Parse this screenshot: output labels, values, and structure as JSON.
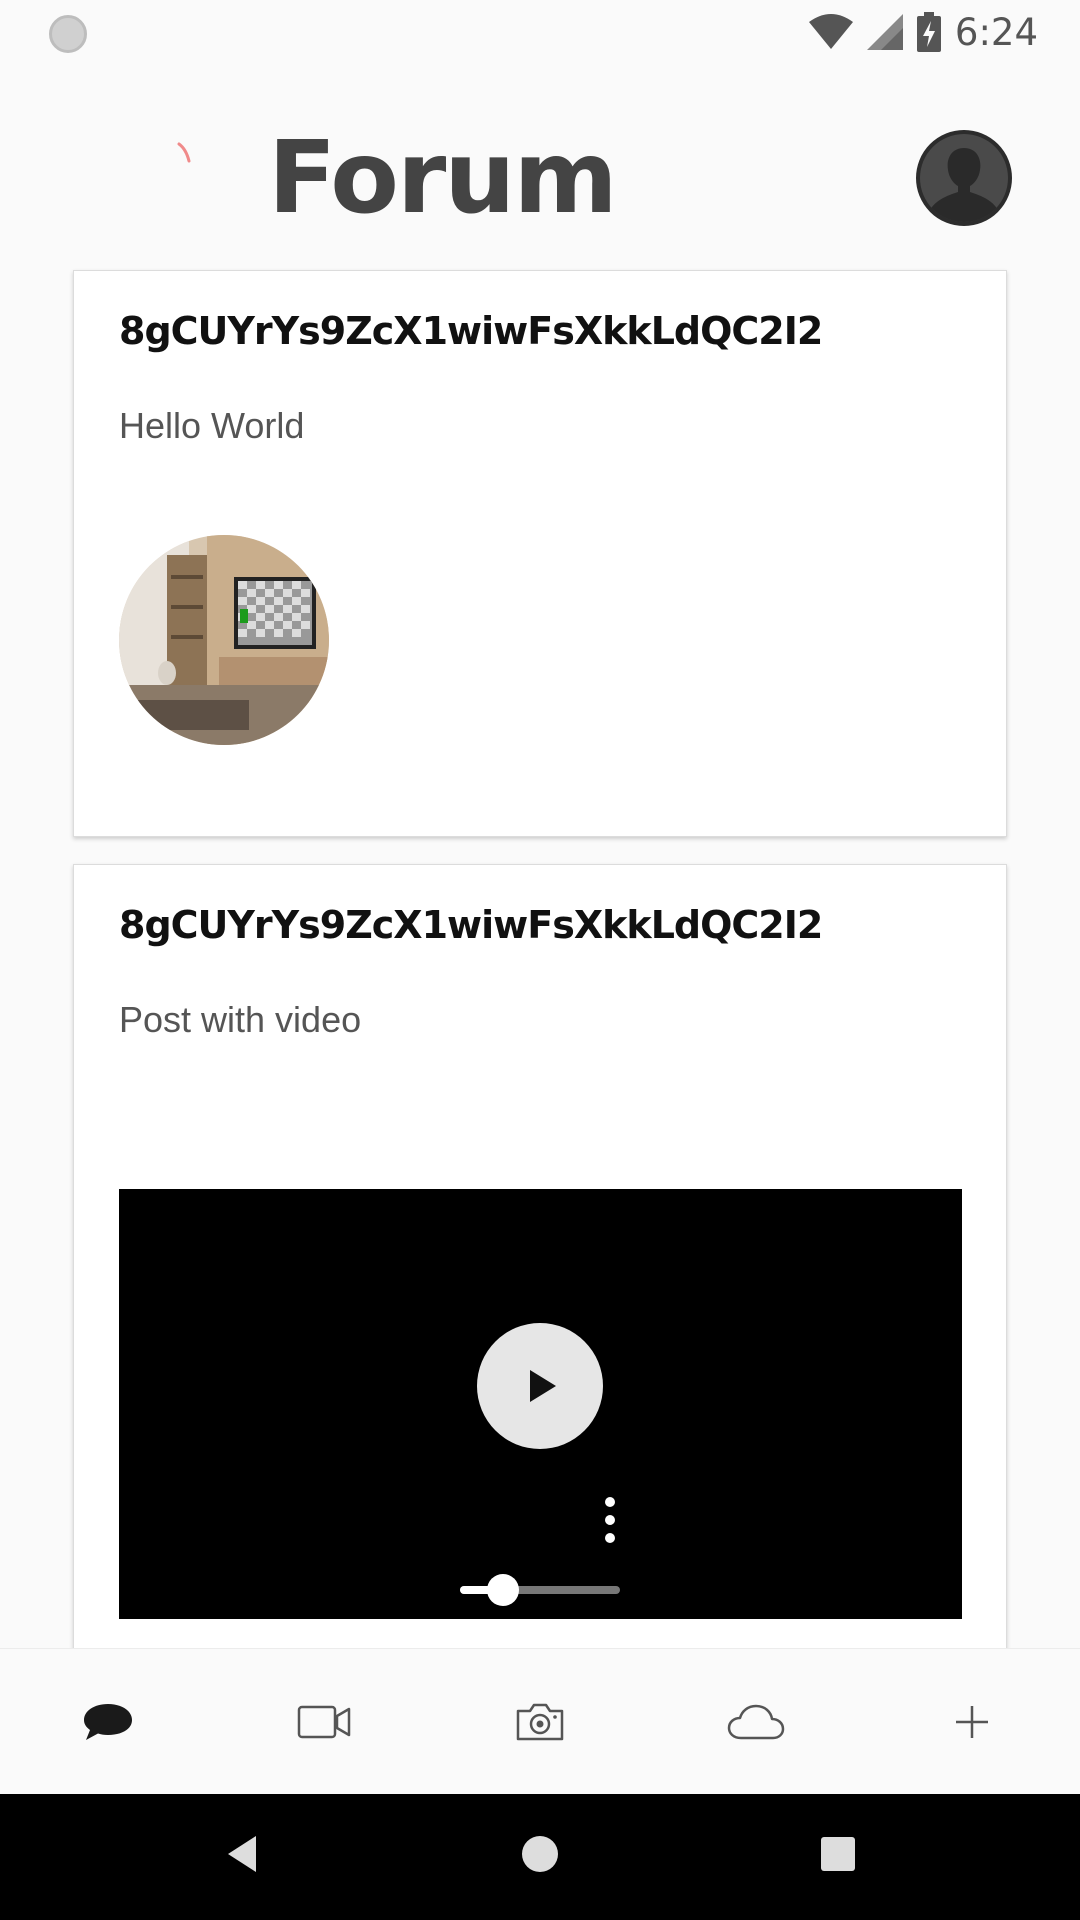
{
  "status_bar": {
    "time": "6:24",
    "icons": [
      "wifi-icon",
      "cell-signal-icon",
      "battery-charging-icon"
    ]
  },
  "header": {
    "title": "Forum",
    "avatar_icon": "user-silhouette-icon"
  },
  "posts": [
    {
      "author": "8gCUYrYs9ZcX1wiwFsXkkLdQC2I2",
      "text": "Hello World",
      "media": "image"
    },
    {
      "author": "8gCUYrYs9ZcX1wiwFsXkkLdQC2I2",
      "text": "Post with video",
      "media": "video",
      "video_progress": 0.27
    }
  ],
  "tabs": [
    {
      "icon": "chat-bubble-icon",
      "selected": true
    },
    {
      "icon": "video-camera-icon",
      "selected": false
    },
    {
      "icon": "photo-camera-icon",
      "selected": false
    },
    {
      "icon": "cloud-icon",
      "selected": false
    },
    {
      "icon": "plus-icon",
      "selected": false
    }
  ],
  "colors": {
    "background": "#fafafa",
    "title": "#444444",
    "tab_selected": "#1a1a1a",
    "tab_unselected": "#555555"
  }
}
